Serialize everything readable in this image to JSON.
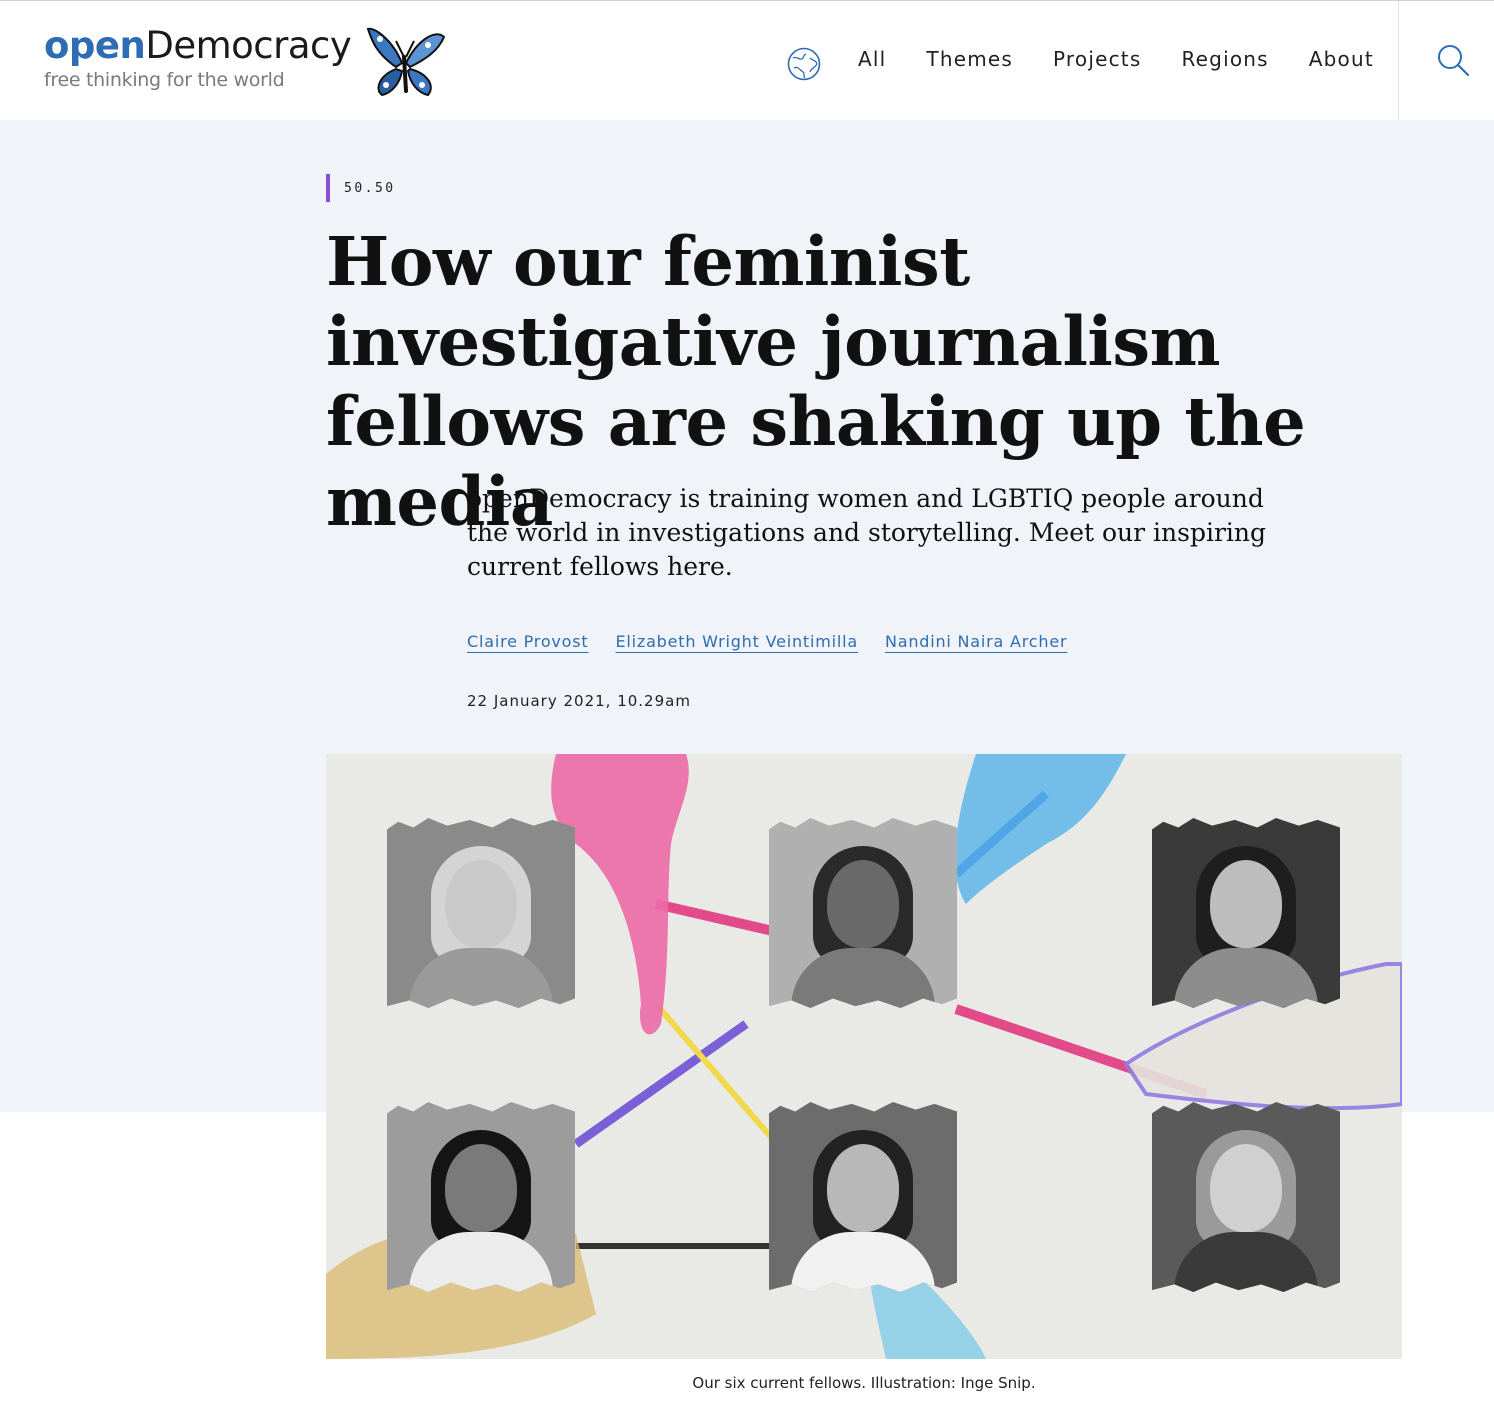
{
  "header": {
    "logo_open": "open",
    "logo_democracy": "Democracy",
    "tagline": "free thinking for the world",
    "nav": [
      "All",
      "Themes",
      "Projects",
      "Regions",
      "About"
    ]
  },
  "article": {
    "section": "50.50",
    "headline": "How our feminist investigative journalism fellows are shaking up the media",
    "standfirst": "openDemocracy is training women and LGBTIQ people around the world in investigations and storytelling. Meet our inspiring current fellows here.",
    "authors": [
      "Claire Provost",
      "Elizabeth Wright Veintimilla",
      "Nandini Naira Archer"
    ],
    "date": "22 January 2021, 10.29am",
    "caption": "Our six current fellows. Illustration: Inge Snip."
  },
  "colors": {
    "brand_blue": "#2f6db3",
    "section_accent": "#8b4fd0",
    "hero_bg": "#f0f3f8"
  },
  "icons": [
    "butterfly-logo-icon",
    "globe-icon",
    "search-icon"
  ]
}
